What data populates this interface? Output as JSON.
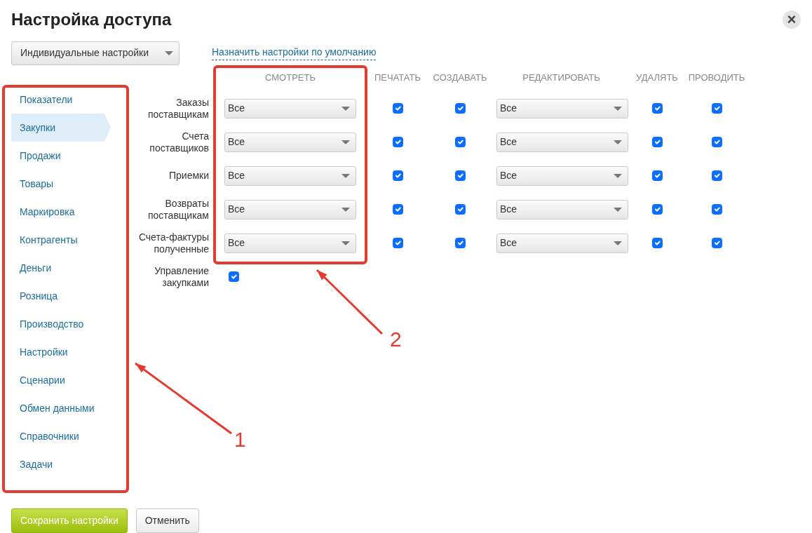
{
  "dialog": {
    "title": "Настройка доступа",
    "close": "×"
  },
  "mode_select": {
    "value": "Индивидуальные настройки"
  },
  "default_link": "Назначить настройки по умолчанию",
  "sidebar": {
    "items": [
      {
        "label": "Показатели",
        "selected": false
      },
      {
        "label": "Закупки",
        "selected": true
      },
      {
        "label": "Продажи",
        "selected": false
      },
      {
        "label": "Товары",
        "selected": false
      },
      {
        "label": "Маркировка",
        "selected": false
      },
      {
        "label": "Контрагенты",
        "selected": false
      },
      {
        "label": "Деньги",
        "selected": false
      },
      {
        "label": "Розница",
        "selected": false
      },
      {
        "label": "Производство",
        "selected": false
      },
      {
        "label": "Настройки",
        "selected": false
      },
      {
        "label": "Сценарии",
        "selected": false
      },
      {
        "label": "Обмен данными",
        "selected": false
      },
      {
        "label": "Справочники",
        "selected": false
      },
      {
        "label": "Задачи",
        "selected": false
      }
    ]
  },
  "table": {
    "columns": [
      "СМОТРЕТЬ",
      "ПЕЧАТАТЬ",
      "СОЗДАВАТЬ",
      "РЕДАКТИРОВАТЬ",
      "УДАЛЯТЬ",
      "ПРОВОДИТЬ"
    ],
    "rows": [
      {
        "kind": "full",
        "label": "Заказы поставщикам",
        "view": "Все",
        "print": true,
        "create": true,
        "edit": "Все",
        "delete": true,
        "conduct": true
      },
      {
        "kind": "full",
        "label": "Счета поставщиков",
        "view": "Все",
        "print": true,
        "create": true,
        "edit": "Все",
        "delete": true,
        "conduct": true
      },
      {
        "kind": "full",
        "label": "Приемки",
        "view": "Все",
        "print": true,
        "create": true,
        "edit": "Все",
        "delete": true,
        "conduct": true
      },
      {
        "kind": "full",
        "label": "Возвраты поставщикам",
        "view": "Все",
        "print": true,
        "create": true,
        "edit": "Все",
        "delete": true,
        "conduct": true
      },
      {
        "kind": "full",
        "label": "Счета-фактуры полученные",
        "view": "Все",
        "print": true,
        "create": true,
        "edit": "Все",
        "delete": true,
        "conduct": true
      },
      {
        "kind": "single",
        "label": "Управление закупками",
        "checked": true
      }
    ]
  },
  "buttons": [
    {
      "label": "Сохранить настройки",
      "kind": "primary"
    },
    {
      "label": "Отменить",
      "kind": "secondary"
    }
  ],
  "annotations": [
    {
      "label": "1"
    },
    {
      "label": "2"
    }
  ]
}
